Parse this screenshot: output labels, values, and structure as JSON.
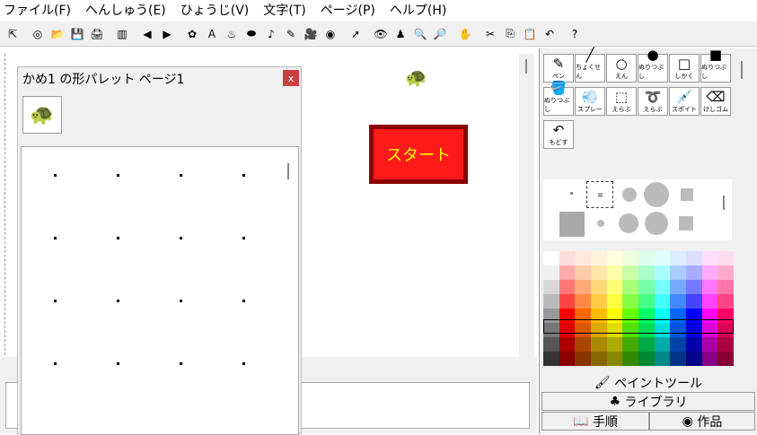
{
  "menu": [
    "ファイル(F)",
    "へんしゅう(E)",
    "ひょうじ(V)",
    "文字(T)",
    "ページ(P)",
    "ヘルプ(H)"
  ],
  "toolbar": [
    "⇱",
    "◎",
    "📂",
    "💾",
    "🖨",
    "▥",
    "◀",
    "▶",
    "✿",
    "A",
    "♨",
    "⬬",
    "♪",
    "✎",
    "🎥",
    "◉",
    "➚",
    "👁",
    "♟",
    "🔍",
    "🔎",
    "✋",
    "✂",
    "⎘",
    "📋",
    "↶",
    "?"
  ],
  "stage": {
    "start_label": "スタート",
    "turtle": "🐢"
  },
  "palette": {
    "title": "かめ1 の形パレット ページ1",
    "close": "x",
    "shape": "🐢"
  },
  "tools": [
    {
      "icon": "✎",
      "label": "ペン"
    },
    {
      "icon": "╱",
      "label": "ちょくせん"
    },
    {
      "icon": "○",
      "label": "えん"
    },
    {
      "icon": "●",
      "label": "ぬりつぶし"
    },
    {
      "icon": "□",
      "label": "しかく"
    },
    {
      "icon": "■",
      "label": "ぬりつぶし"
    },
    {
      "icon": "🪣",
      "label": "ぬりつぶし"
    },
    {
      "icon": "💨",
      "label": "スプレー"
    },
    {
      "icon": "⬚",
      "label": "えらぶ"
    },
    {
      "icon": "➰",
      "label": "えらぶ"
    },
    {
      "icon": "💉",
      "label": "スポイト"
    },
    {
      "icon": "⌫",
      "label": "けしゴム"
    },
    {
      "icon": "↶",
      "label": "もどす"
    }
  ],
  "tabs": {
    "paint": "ペイントツール",
    "library": "ライブラリ",
    "steps": "手順",
    "works": "作品"
  },
  "colors": [
    "#ffffff",
    "#ffdddd",
    "#ffe8dd",
    "#fff3dd",
    "#ffffdd",
    "#eeffdd",
    "#ddffee",
    "#ddffff",
    "#ddeeff",
    "#ddddff",
    "#ffddff",
    "#ffddee",
    "#f0f0f0",
    "#ffaaaa",
    "#ffccaa",
    "#ffe8aa",
    "#ffffaa",
    "#ccffaa",
    "#aaffcc",
    "#aaffff",
    "#aaccff",
    "#aaaaff",
    "#ffaaff",
    "#ffaacc",
    "#d8d8d8",
    "#ff7777",
    "#ffaa77",
    "#ffd877",
    "#ffff77",
    "#aaff77",
    "#77ffaa",
    "#77ffff",
    "#77aaff",
    "#7777ff",
    "#ff77ff",
    "#ff77aa",
    "#bbbbbb",
    "#ff4444",
    "#ff8844",
    "#ffcc44",
    "#ffff44",
    "#88ff44",
    "#44ff88",
    "#44ffff",
    "#4488ff",
    "#4444ff",
    "#ff44ff",
    "#ff4488",
    "#999999",
    "#ff0000",
    "#ff6600",
    "#ffbb00",
    "#ffff00",
    "#66ff00",
    "#00ff66",
    "#00ffff",
    "#0066ff",
    "#0000ff",
    "#ff00ff",
    "#ff0066",
    "#777777",
    "#dd0000",
    "#dd5500",
    "#ddaa00",
    "#dddd00",
    "#55dd00",
    "#00dd55",
    "#00dddd",
    "#0055dd",
    "#0000dd",
    "#dd00dd",
    "#dd0055",
    "#555555",
    "#aa0000",
    "#aa4400",
    "#aa8800",
    "#aaaa00",
    "#44aa00",
    "#00aa44",
    "#00aaaa",
    "#0044aa",
    "#0000aa",
    "#aa00aa",
    "#aa0044",
    "#333333",
    "#880000",
    "#883300",
    "#886600",
    "#888800",
    "#338800",
    "#008833",
    "#008888",
    "#003388",
    "#000088",
    "#880088",
    "#880033"
  ]
}
